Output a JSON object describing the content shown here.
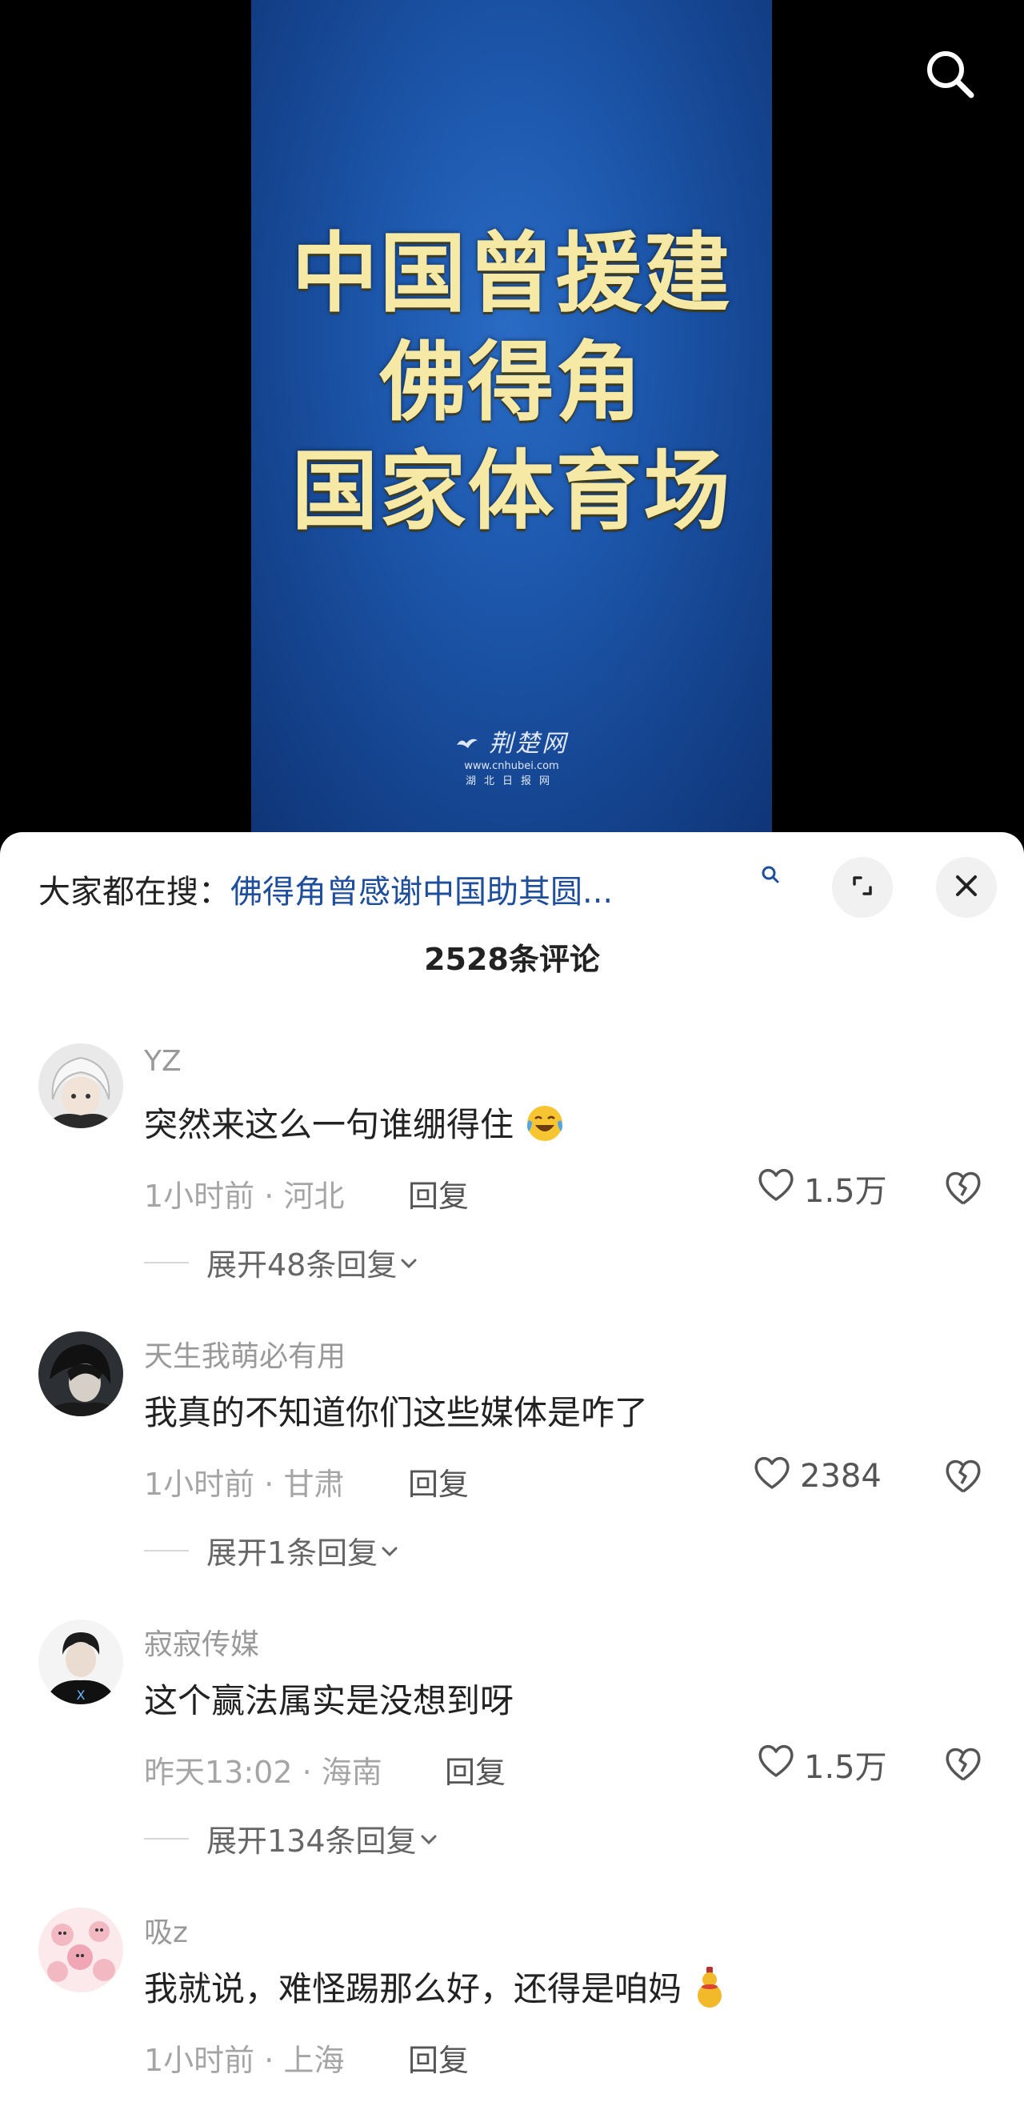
{
  "video": {
    "title_lines": [
      "中国曾援建",
      "佛得角",
      "国家体育场"
    ],
    "watermark_logo": "荆楚网",
    "watermark_url": "www.cnhubei.com",
    "watermark_sub": "湖北日报网"
  },
  "sheet": {
    "trending_prefix": "大家都在搜：",
    "trending_query": "佛得角曾感谢中国助其圆...",
    "comment_count": "2528条评论"
  },
  "comments": [
    {
      "username": "YZ",
      "text": "突然来这么一句谁绷得住",
      "emoji": "laugh-cry",
      "time": "1小时前",
      "location": "河北",
      "reply": "回复",
      "likes": "1.5万",
      "expand": "展开48条回复"
    },
    {
      "username": "天生我萌必有用",
      "text": "我真的不知道你们这些媒体是咋了",
      "time": "1小时前",
      "location": "甘肃",
      "reply": "回复",
      "likes": "2384",
      "expand": "展开1条回复"
    },
    {
      "username": "寂寂传媒",
      "text": "这个赢法属实是没想到呀",
      "time": "昨天13:02",
      "location": "海南",
      "reply": "回复",
      "likes": "1.5万",
      "expand": "展开134条回复"
    },
    {
      "username": "吸z",
      "text": "我就说，难怪踢那么好，还得是咱妈",
      "emoji": "gourd",
      "time": "1小时前",
      "location": "上海",
      "reply": "回复"
    }
  ],
  "colors": {
    "video_bg": "#1d58ad",
    "title_text": "#f6e9a6",
    "link_blue": "#1f4e9c",
    "meta_gray": "#a5a5a5"
  }
}
